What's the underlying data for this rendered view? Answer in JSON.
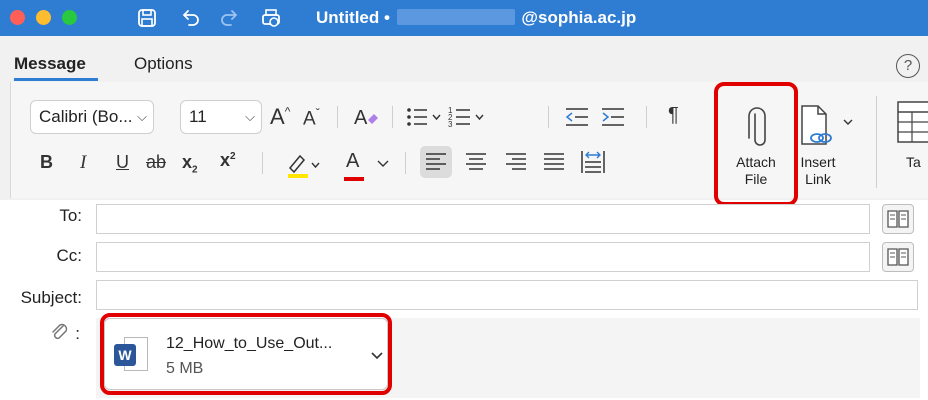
{
  "window": {
    "title_prefix": "Untitled •",
    "title_suffix": "@sophia.ac.jp"
  },
  "tabs": [
    {
      "label": "Message",
      "active": true
    },
    {
      "label": "Options",
      "active": false
    }
  ],
  "ribbon": {
    "font_name": "Calibri (Bo...",
    "font_size": "11",
    "attach_file_line1": "Attach",
    "attach_file_line2": "File",
    "insert_link_line1": "Insert",
    "insert_link_line2": "Link",
    "table_partial": "Ta",
    "bold": "B",
    "italic": "I",
    "underline": "U",
    "strike": "ab",
    "subscript": "x",
    "superscript": "x",
    "font_color": "A",
    "grow_font": "A",
    "shrink_font": "A",
    "pilcrow": "¶"
  },
  "fields": {
    "to_label": "To:",
    "cc_label": "Cc:",
    "subject_label": "Subject:",
    "attach_label": ":"
  },
  "attachment": {
    "name": "12_How_to_Use_Out...",
    "size": "5 MB"
  },
  "colors": {
    "titlebar": "#2f7cd3",
    "highlight_box": "#e00000",
    "highlight_color": "#ffe500",
    "font_color": "#e00000"
  }
}
